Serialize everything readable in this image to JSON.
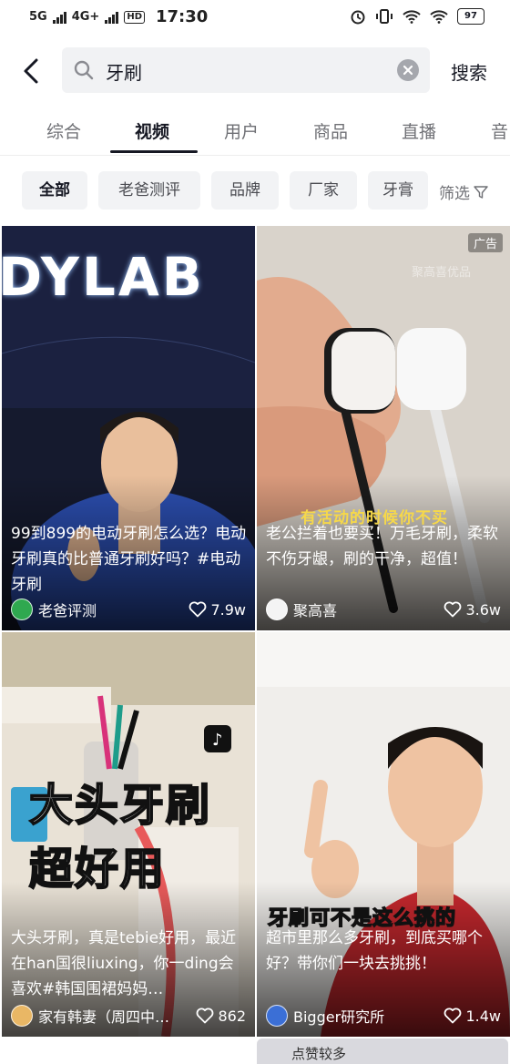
{
  "status_bar": {
    "network_1": "5G",
    "network_2": "4G+",
    "hd": "HD",
    "time": "17:30",
    "battery": "97"
  },
  "search": {
    "query": "牙刷",
    "button": "搜索"
  },
  "tabs": [
    {
      "label": "综合"
    },
    {
      "label": "视频",
      "active": true
    },
    {
      "label": "用户"
    },
    {
      "label": "商品"
    },
    {
      "label": "直播"
    },
    {
      "label": "音"
    }
  ],
  "chips": [
    {
      "label": "全部",
      "active": true
    },
    {
      "label": "老爸测评"
    },
    {
      "label": "品牌"
    },
    {
      "label": "厂家"
    },
    {
      "label": "牙膏"
    }
  ],
  "filter_label": "筛选",
  "videos": [
    {
      "title": "99到899的电动牙刷怎么选？电动牙刷真的比普通牙刷好吗？#电动牙刷",
      "author": "老爸评测",
      "likes": "7.9w",
      "overlay": "DYLAB",
      "avatar_color": "#2fa84f"
    },
    {
      "title": "老公拦着也要买！万毛牙刷，柔软不伤牙龈，刷的干净，超值！",
      "author": "聚高喜",
      "likes": "3.6w",
      "ad": "广告",
      "caption": "有活动的时候你不买",
      "watermark": "聚高喜优品",
      "avatar_color": "#f4f4f4"
    },
    {
      "title": "大头牙刷，真是tebie好用，最近在han国很liuxing，你一ding会喜欢#韩国围裙妈妈…",
      "author": "家有韩妻（周四中…",
      "likes": "862",
      "overlay_1": "大头牙刷",
      "overlay_2": "超好用",
      "avatar_color": "#e9b765"
    },
    {
      "title": "超市里那么多牙刷，到底买哪个好？带你们一块去挑挑！",
      "author": "Bigger研究所",
      "likes": "1.4w",
      "caption": "牙刷可不是这么挑的",
      "avatar_color": "#3b6fd6"
    }
  ],
  "bottom_banner": "点赞较多"
}
